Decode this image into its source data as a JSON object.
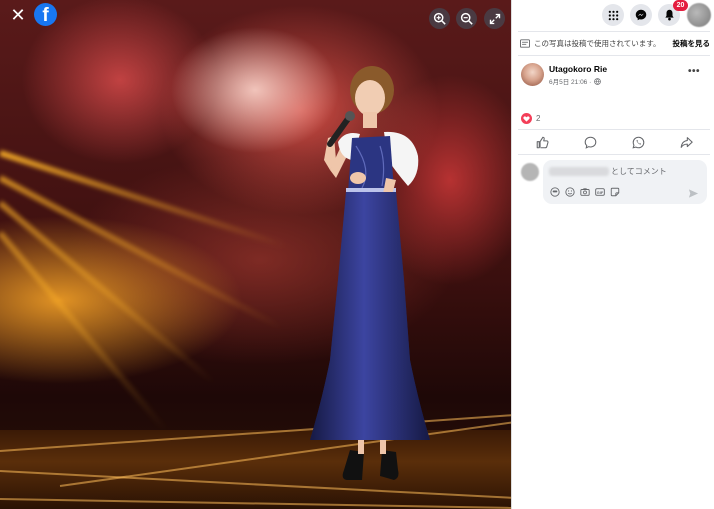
{
  "viewer": {
    "close_icon": "close-icon",
    "logo_letter": "f",
    "tools": [
      "zoom-in-icon",
      "zoom-out-icon",
      "fullscreen-icon"
    ]
  },
  "topbar": {
    "notification_count": "20"
  },
  "usage_notice": {
    "text": "この写真は投稿で使用されています。",
    "link": "投稿を見る"
  },
  "post": {
    "author": "Utagokoro Rie",
    "date": "6月5日 21:06 ·"
  },
  "reactions": {
    "count": "2"
  },
  "comment": {
    "placeholder": "としてコメント"
  },
  "colors": {
    "facebook_blue": "#1877f2",
    "badge_red": "#e41e3f",
    "love_red": "#f33e58"
  }
}
